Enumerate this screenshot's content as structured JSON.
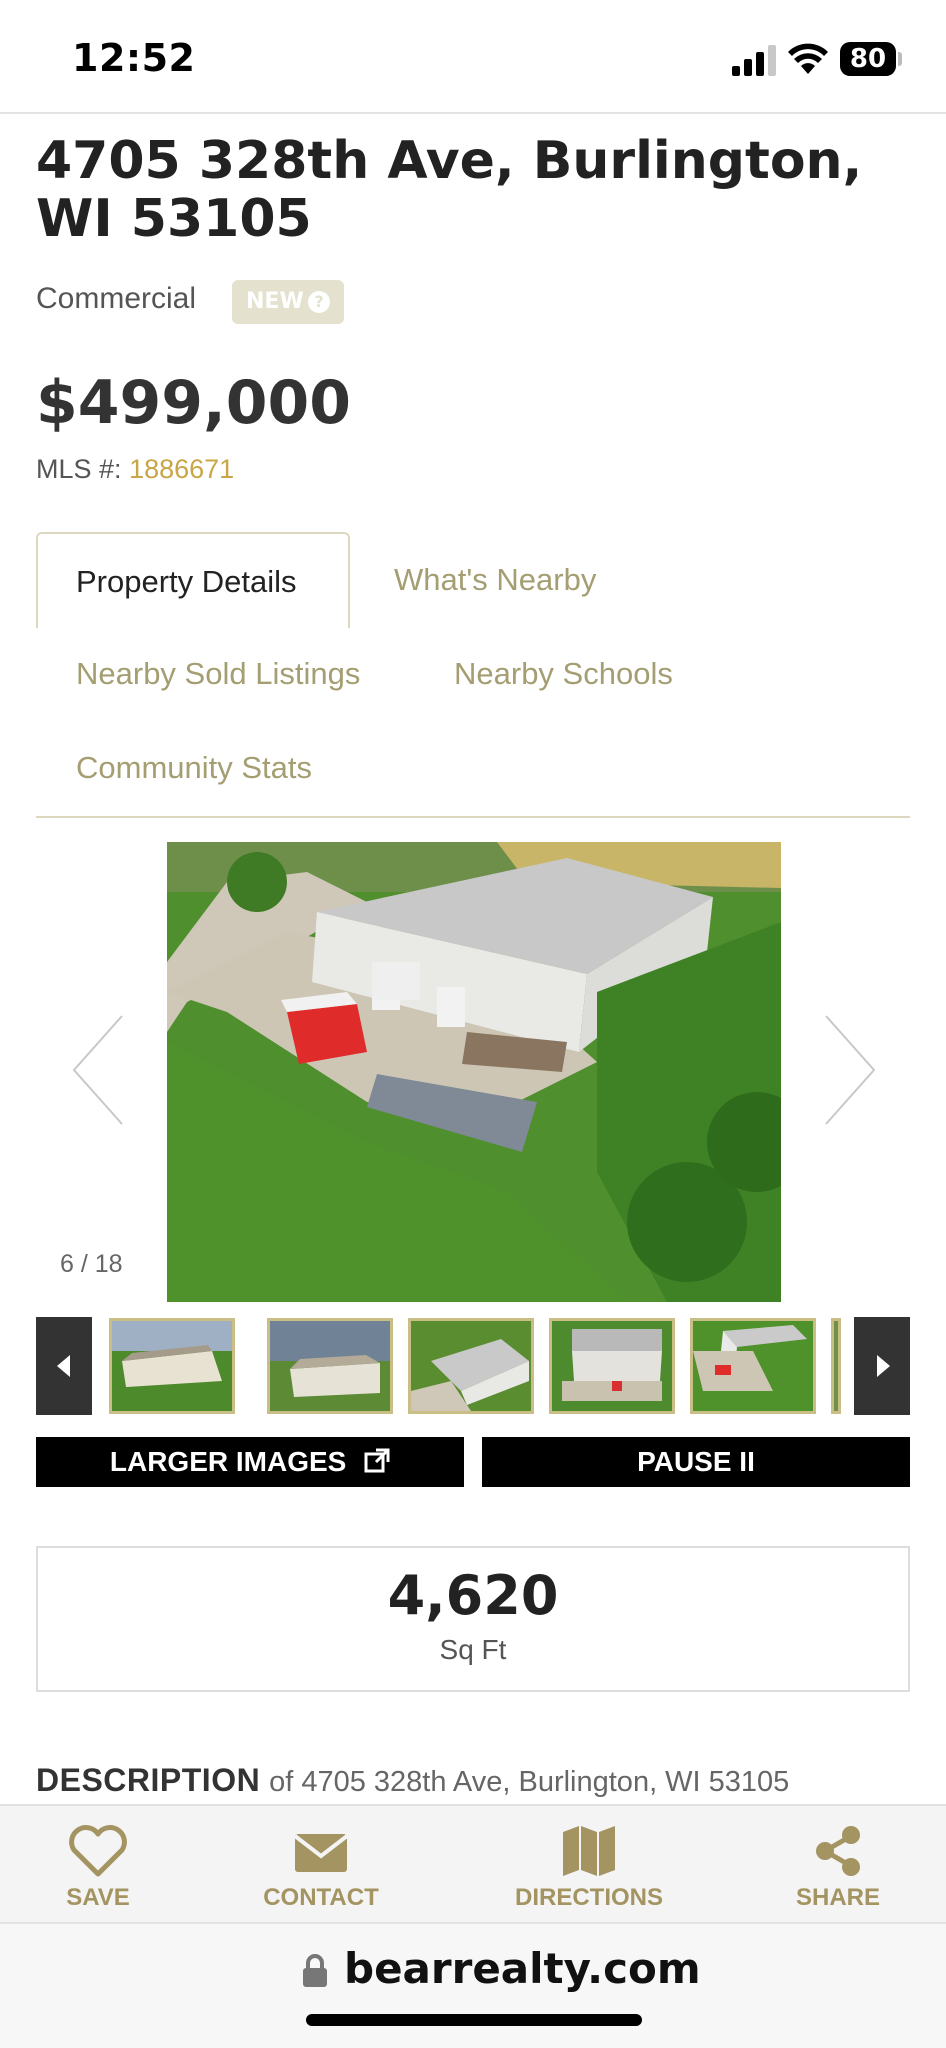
{
  "status": {
    "time": "12:52",
    "battery": "80"
  },
  "listing": {
    "address": "4705 328th Ave, Burlington, WI 53105",
    "type": "Commercial",
    "badge": "NEW",
    "badge_icon": "?",
    "price": "$499,000",
    "mls_label": "MLS #:",
    "mls_number": "1886671"
  },
  "tabs": [
    {
      "label": "Property Details",
      "active": true
    },
    {
      "label": "What's Nearby",
      "active": false
    },
    {
      "label": "Nearby Sold Listings",
      "active": false
    },
    {
      "label": "Nearby Schools",
      "active": false
    },
    {
      "label": "Community Stats",
      "active": false
    }
  ],
  "gallery": {
    "counter": "6 / 18",
    "larger_images": "LARGER IMAGES",
    "pause": "PAUSE II"
  },
  "stats": {
    "sqft_value": "4,620",
    "sqft_label": "Sq Ft"
  },
  "description": {
    "heading": "DESCRIPTION",
    "subtitle": "of 4705 328th Ave, Burlington, WI 53105"
  },
  "actions": [
    {
      "label": "SAVE",
      "icon": "heart-icon"
    },
    {
      "label": "CONTACT",
      "icon": "envelope-icon"
    },
    {
      "label": "DIRECTIONS",
      "icon": "map-icon"
    },
    {
      "label": "SHARE",
      "icon": "share-icon"
    }
  ],
  "browser": {
    "url": "bearrealty.com"
  },
  "colors": {
    "accent": "#a49e72",
    "mls_link": "#c9a546",
    "badge_bg": "#e4e1cf"
  }
}
